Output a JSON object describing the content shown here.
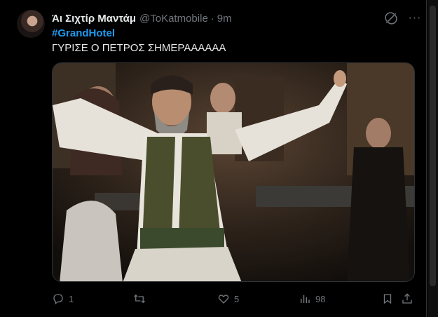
{
  "tweet": {
    "display_name": "Άι Σιχτίρ Μαντάμ",
    "handle": "@ToKatmobile",
    "separator": "·",
    "time": "9m",
    "hashtag": "#GrandHotel",
    "text": "ΓΥΡΙΣΕ Ο ΠΕΤΡΟΣ ΣΗΜΕΡΑΑΑΑΑΑ",
    "more_label": "···"
  },
  "actions": {
    "reply_count": "1",
    "retweet_count": "",
    "like_count": "5",
    "views_count": "98"
  },
  "icons": {
    "avatar": "avatar",
    "grok": "grok-icon",
    "more": "more-icon",
    "reply": "reply-icon",
    "retweet": "retweet-icon",
    "like": "like-icon",
    "views": "views-icon",
    "bookmark": "bookmark-icon",
    "share": "share-icon"
  },
  "colors": {
    "background": "#000000",
    "text": "#e7e9ea",
    "secondary": "#71767b",
    "link": "#1d9bf0",
    "border": "#2f3336"
  }
}
